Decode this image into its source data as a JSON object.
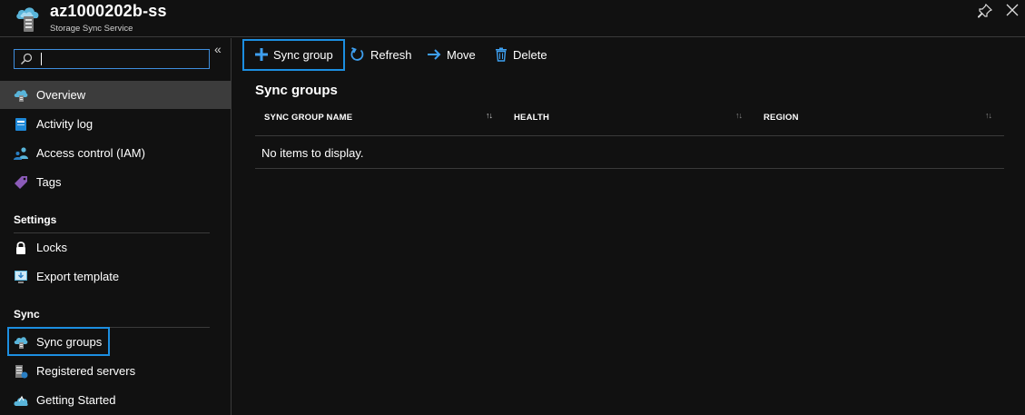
{
  "header": {
    "title": "az1000202b-ss",
    "subtitle": "Storage Sync Service"
  },
  "search": {
    "placeholder": "",
    "value": ""
  },
  "sidebar": {
    "items": [
      {
        "label": "Overview"
      },
      {
        "label": "Activity log"
      },
      {
        "label": "Access control (IAM)"
      },
      {
        "label": "Tags"
      }
    ],
    "settings": {
      "title": "Settings",
      "items": [
        {
          "label": "Locks"
        },
        {
          "label": "Export template"
        }
      ]
    },
    "sync": {
      "title": "Sync",
      "items": [
        {
          "label": "Sync groups"
        },
        {
          "label": "Registered servers"
        },
        {
          "label": "Getting Started"
        }
      ]
    }
  },
  "toolbar": {
    "sync_group_label": "Sync group",
    "refresh_label": "Refresh",
    "move_label": "Move",
    "delete_label": "Delete"
  },
  "main": {
    "title": "Sync groups",
    "columns": [
      "SYNC GROUP NAME",
      "HEALTH",
      "REGION"
    ],
    "empty_message": "No items to display."
  },
  "colors": {
    "accent": "#1c8ee0",
    "background": "#111111",
    "selected": "#3c3c3c"
  }
}
